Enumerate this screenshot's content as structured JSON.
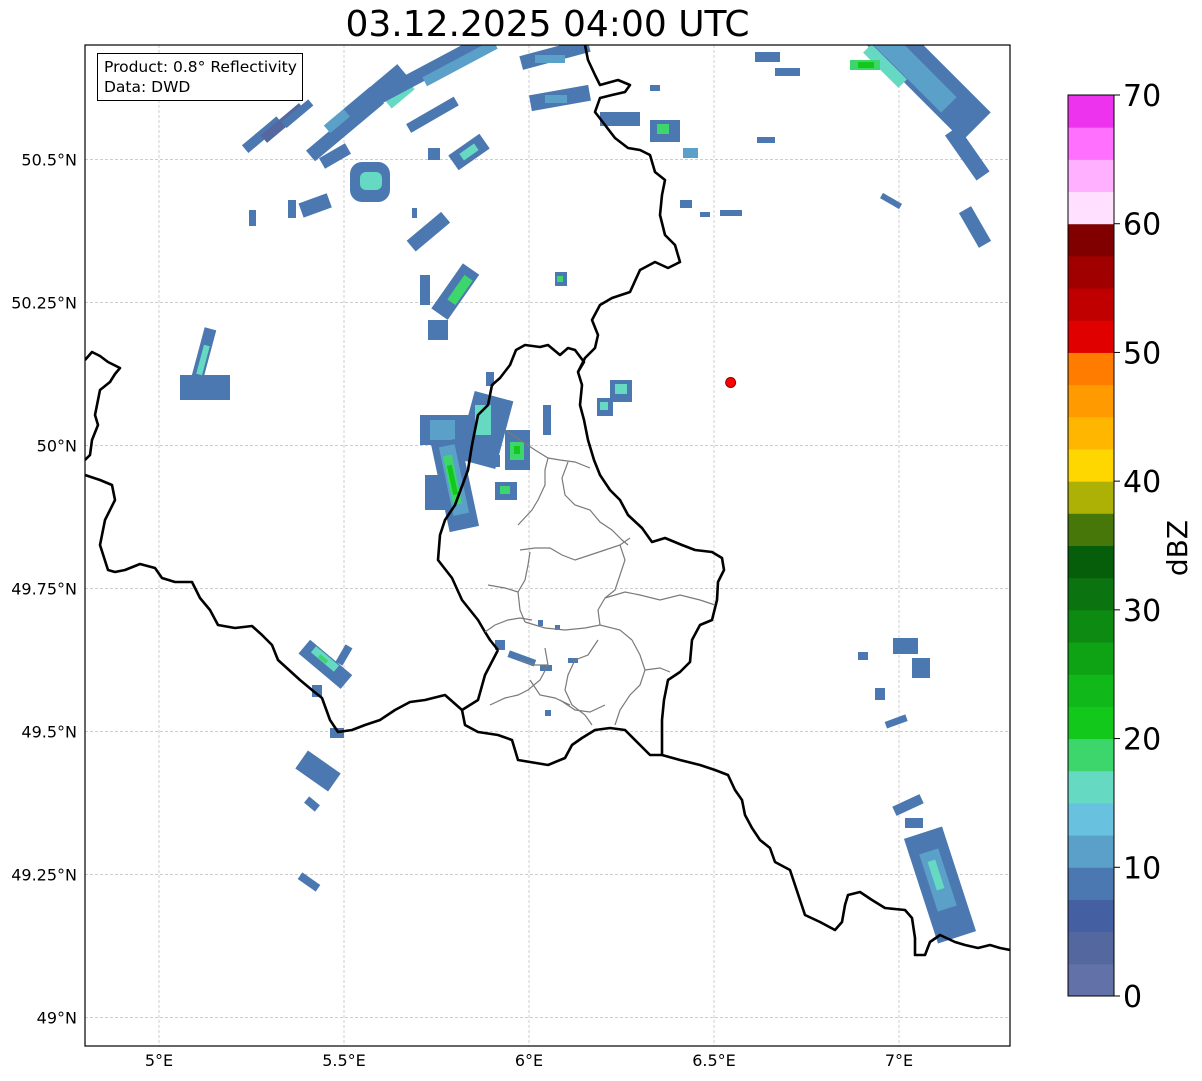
{
  "title": "03.12.2025 04:00 UTC",
  "info_box": {
    "product": "Product: 0.8° Reflectivity",
    "data": "Data: DWD"
  },
  "map": {
    "lon_range": [
      4.8,
      7.3
    ],
    "lat_range": [
      48.95,
      50.7
    ],
    "lon_ticks": [
      {
        "value": 5.0,
        "label": "5°E"
      },
      {
        "value": 5.5,
        "label": "5.5°E"
      },
      {
        "value": 6.0,
        "label": "6°E"
      },
      {
        "value": 6.5,
        "label": "6.5°E"
      },
      {
        "value": 7.0,
        "label": "7°E"
      }
    ],
    "lat_ticks": [
      {
        "value": 49.0,
        "label": "49°N"
      },
      {
        "value": 49.25,
        "label": "49.25°N"
      },
      {
        "value": 49.5,
        "label": "49.5°N"
      },
      {
        "value": 49.75,
        "label": "49.75°N"
      },
      {
        "value": 50.0,
        "label": "50°N"
      },
      {
        "value": 50.25,
        "label": "50.25°N"
      },
      {
        "value": 50.5,
        "label": "50.5°N"
      }
    ],
    "gridlines": true,
    "marker": {
      "lon": 6.545,
      "lat": 50.11,
      "color": "#ff0000"
    }
  },
  "colorbar": {
    "label": "dBZ",
    "min": 0,
    "max": 70,
    "tick_labels": [
      "0",
      "10",
      "20",
      "30",
      "40",
      "50",
      "60",
      "70"
    ],
    "colors": [
      "#6272a8",
      "#54689f",
      "#455fa3",
      "#4b78b0",
      "#5ba0c8",
      "#68c1de",
      "#66d9c2",
      "#3dd66c",
      "#12c81a",
      "#10b81a",
      "#0ea215",
      "#0d8a12",
      "#0b730f",
      "#075e0a",
      "#467708",
      "#adb105",
      "#ffd700",
      "#ffb600",
      "#ff9a00",
      "#ff7c00",
      "#e00000",
      "#c00000",
      "#a00000",
      "#800000",
      "#ffe0ff",
      "#ffb0ff",
      "#ff70ff",
      "#ee33ee"
    ]
  }
}
